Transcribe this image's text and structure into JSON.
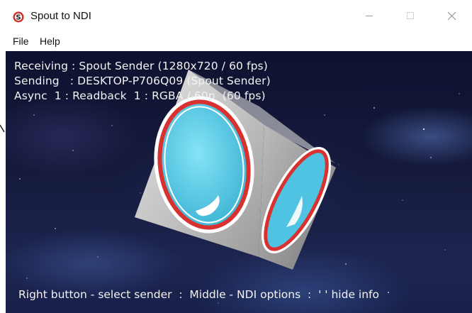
{
  "window": {
    "title": "Spout to NDI",
    "icon": "spout-logo-icon",
    "controls": [
      "minimize-icon",
      "maximize-icon",
      "close-icon"
    ]
  },
  "menu": {
    "items": [
      {
        "label": "File"
      },
      {
        "label": "Help"
      }
    ]
  },
  "overlay": {
    "receiving": "Receiving : Spout Sender (1280x720 / 60 fps)",
    "sending": "Sending   : DESKTOP-P706Q09 (Spout Sender)",
    "async": "Async  1 : Readback  1 : RGBA / 60p  (60 fps)",
    "hint": "Right button - select sender  :  Middle - NDI options  :  ' ' hide info"
  },
  "colors": {
    "cube_face": "#cfcfcf",
    "ring_red": "#d93030",
    "disc_cyan": "#5ccbe6",
    "background": "#151a3c"
  }
}
